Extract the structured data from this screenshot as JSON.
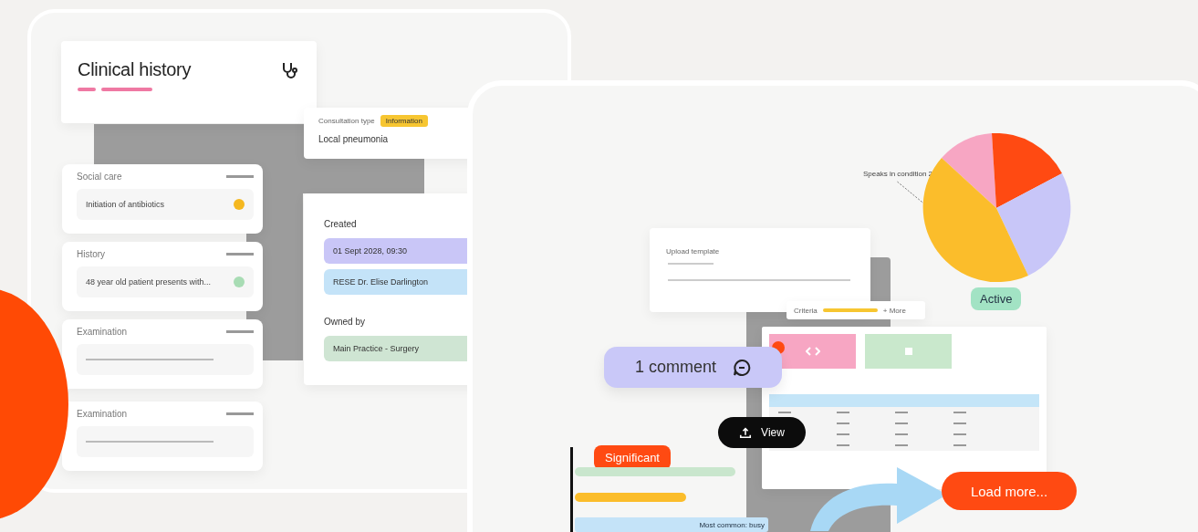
{
  "clinical_history": {
    "title": "Clinical history",
    "sections": [
      {
        "heading": "Social care",
        "entry": "Initiation of antibiotics",
        "color": "#f5b820"
      },
      {
        "heading": "History",
        "entry": "48 year old patient presents with...",
        "color": "#a8dcb4"
      },
      {
        "heading": "Examination"
      },
      {
        "heading": "Examination"
      }
    ]
  },
  "consultation": {
    "type_label": "Consultation type",
    "tag": "Information",
    "diagnosis": "Local pneumonia"
  },
  "details": {
    "created_label": "Created",
    "created": "01 Sept 2028, 09:30",
    "author": "RESE Dr. Elise Darlington",
    "owned_label": "Owned by",
    "owner": "Main Practice - Surgery"
  },
  "template": {
    "title": "Upload template"
  },
  "criteria": {
    "label": "Criteria",
    "more": "+ More"
  },
  "pie_label": "Speaks in condition 2",
  "status_badge": "Active",
  "comment_button": "1 comment",
  "view_button": "View",
  "significant_tag": "Significant",
  "load_more_button": "Load more...",
  "bar_caption": "Most common: busy"
}
